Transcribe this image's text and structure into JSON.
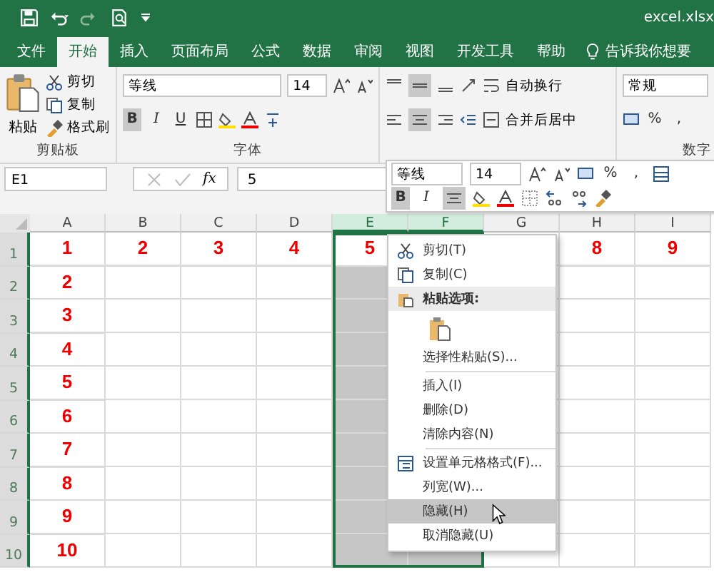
{
  "title_bar": {
    "file_name": "excel.xlsx"
  },
  "tabs": [
    {
      "label": "文件",
      "selected": false
    },
    {
      "label": "开始",
      "selected": true
    },
    {
      "label": "插入",
      "selected": false
    },
    {
      "label": "页面布局",
      "selected": false
    },
    {
      "label": "公式",
      "selected": false
    },
    {
      "label": "数据",
      "selected": false
    },
    {
      "label": "审阅",
      "selected": false
    },
    {
      "label": "视图",
      "selected": false
    },
    {
      "label": "开发工具",
      "selected": false
    },
    {
      "label": "帮助",
      "selected": false
    }
  ],
  "tell_me": "告诉我你想要",
  "ribbon": {
    "clipboard": {
      "paste": "粘贴",
      "cut": "剪切",
      "copy": "复制",
      "format_painter": "格式刷",
      "label": "剪贴板"
    },
    "font": {
      "font_name": "等线",
      "font_size": "14",
      "bold": "B",
      "italic": "I",
      "underline": "U",
      "bold_on": true,
      "label": "字体"
    },
    "alignment": {
      "wrap_text": "自动换行",
      "merge_center": "合并后居中",
      "middle_on": true,
      "center_on": true
    },
    "number": {
      "format": "常规",
      "percent": "%",
      "comma": ",",
      "label": "数字"
    }
  },
  "formula_bar": {
    "name_box": "E1",
    "fx": "fx",
    "value": "5"
  },
  "mini_toolbar": {
    "font_name": "等线",
    "font_size": "14",
    "percent": "%",
    "comma": ",",
    "bold": "B",
    "italic": "I",
    "bold_on": true,
    "center_on": true
  },
  "sheet": {
    "columns": [
      {
        "label": "A",
        "selected": false
      },
      {
        "label": "B",
        "selected": false
      },
      {
        "label": "C",
        "selected": false
      },
      {
        "label": "D",
        "selected": false
      },
      {
        "label": "E",
        "selected": true
      },
      {
        "label": "F",
        "selected": true
      },
      {
        "label": "G",
        "selected": false
      },
      {
        "label": "H",
        "selected": false
      },
      {
        "label": "I",
        "selected": false
      }
    ],
    "rows": [
      {
        "label": "1",
        "cells": [
          "1",
          "2",
          "3",
          "4",
          "5",
          null,
          null,
          "8",
          "9"
        ]
      },
      {
        "label": "2",
        "cells": [
          "2"
        ]
      },
      {
        "label": "3",
        "cells": [
          "3"
        ]
      },
      {
        "label": "4",
        "cells": [
          "4"
        ]
      },
      {
        "label": "5",
        "cells": [
          "5"
        ]
      },
      {
        "label": "6",
        "cells": [
          "6"
        ]
      },
      {
        "label": "7",
        "cells": [
          "7"
        ]
      },
      {
        "label": "8",
        "cells": [
          "8"
        ]
      },
      {
        "label": "9",
        "cells": [
          "9"
        ]
      },
      {
        "label": "10",
        "cells": [
          "10"
        ]
      }
    ]
  },
  "context_menu": [
    {
      "kind": "command",
      "label": "剪切(T)",
      "selected": false
    },
    {
      "kind": "command",
      "label": "复制(C)",
      "selected": false
    },
    {
      "kind": "header",
      "label": "粘贴选项:"
    },
    {
      "kind": "paste_option"
    },
    {
      "kind": "command",
      "label": "选择性粘贴(S)...",
      "selected": false
    },
    {
      "kind": "separator"
    },
    {
      "kind": "command",
      "label": "插入(I)",
      "selected": false
    },
    {
      "kind": "command",
      "label": "删除(D)",
      "selected": false
    },
    {
      "kind": "command",
      "label": "清除内容(N)",
      "selected": false
    },
    {
      "kind": "separator"
    },
    {
      "kind": "command",
      "label": "设置单元格格式(F)...",
      "selected": false
    },
    {
      "kind": "command",
      "label": "列宽(W)...",
      "selected": false
    },
    {
      "kind": "command",
      "label": "隐藏(H)",
      "selected": true
    },
    {
      "kind": "command",
      "label": "取消隐藏(U)",
      "selected": false
    }
  ]
}
